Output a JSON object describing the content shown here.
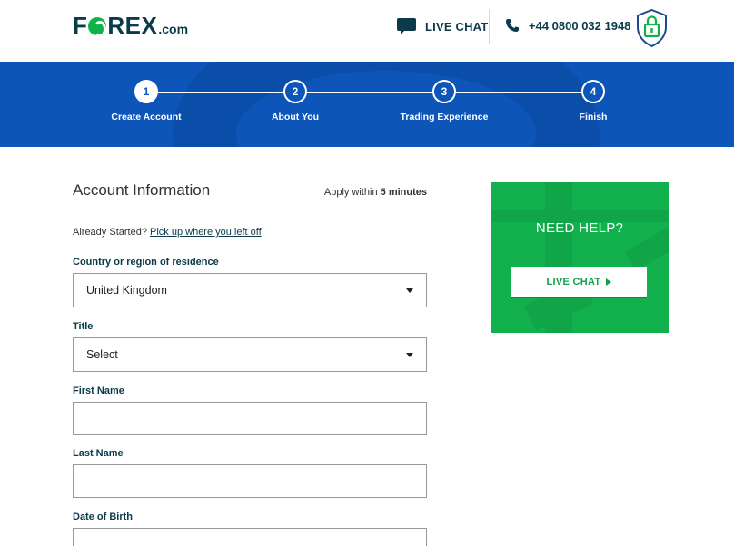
{
  "header": {
    "logo_left": "F",
    "logo_right": "REX",
    "logo_domain": ".com",
    "live_chat_label": "LIVE CHAT",
    "phone_number": "+44 0800 032 1948"
  },
  "progress": {
    "steps": [
      {
        "number": "1",
        "label": "Create Account"
      },
      {
        "number": "2",
        "label": "About You"
      },
      {
        "number": "3",
        "label": "Trading Experience"
      },
      {
        "number": "4",
        "label": "Finish"
      }
    ],
    "active_step": 1
  },
  "form": {
    "title": "Account Information",
    "apply_prefix": "Apply within",
    "apply_time": "5 minutes",
    "already_started": "Already Started?",
    "pick_up_link": "Pick up where you left off",
    "country_label": "Country or region of residence",
    "country_value": "United Kingdom",
    "title_label": "Title",
    "title_value": "Select",
    "first_name_label": "First Name",
    "first_name_value": "",
    "last_name_label": "Last Name",
    "last_name_value": "",
    "dob_label": "Date of Birth"
  },
  "help": {
    "title": "NEED HELP?",
    "button_label": "LIVE CHAT"
  },
  "colors": {
    "brand_navy": "#0b3a4a",
    "brand_green": "#10b34a",
    "banner_blue": "#0d55b9",
    "help_green": "#13b04e"
  }
}
